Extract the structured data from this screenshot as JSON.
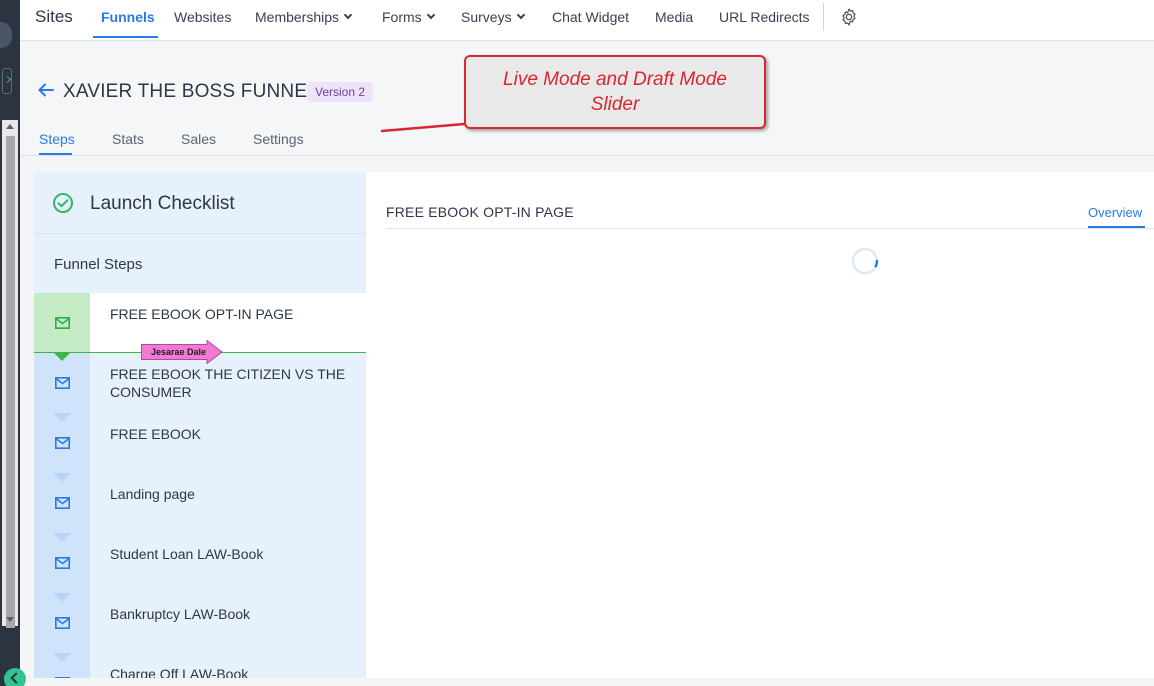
{
  "nav": {
    "brand": "Sites",
    "items": [
      {
        "label": "Funnels"
      },
      {
        "label": "Websites"
      },
      {
        "label": "Memberships"
      },
      {
        "label": "Forms"
      },
      {
        "label": "Surveys"
      },
      {
        "label": "Chat Widget"
      },
      {
        "label": "Media"
      },
      {
        "label": "URL Redirects"
      }
    ],
    "settings_icon": "gear-icon"
  },
  "header": {
    "title": "XAVIER THE BOSS FUNNEL",
    "version": "Version 2",
    "tabs": [
      {
        "label": "Steps"
      },
      {
        "label": "Stats"
      },
      {
        "label": "Sales"
      },
      {
        "label": "Settings"
      }
    ]
  },
  "sidebar": {
    "checklist_label": "Launch Checklist",
    "steps_heading": "Funnel Steps",
    "steps": [
      {
        "label": "FREE EBOOK OPT-IN PAGE"
      },
      {
        "label": "FREE EBOOK THE CITIZEN VS THE CONSUMER"
      },
      {
        "label": "FREE EBOOK"
      },
      {
        "label": "Landing page"
      },
      {
        "label": "Student Loan LAW-Book"
      },
      {
        "label": "Bankruptcy LAW-Book"
      },
      {
        "label": "Charge Off LAW-Book"
      }
    ],
    "user_tag": "Jesarae Dale"
  },
  "main": {
    "page_title": "FREE EBOOK OPT-IN PAGE",
    "overview_tab": "Overview"
  },
  "annotation": {
    "line1": "Live Mode and Draft Mode",
    "line2": "Slider"
  },
  "colors": {
    "accent": "#2c7be5",
    "active_step": "#3db54a",
    "annotation": "#d9262f",
    "tag": "#f27ad5"
  }
}
